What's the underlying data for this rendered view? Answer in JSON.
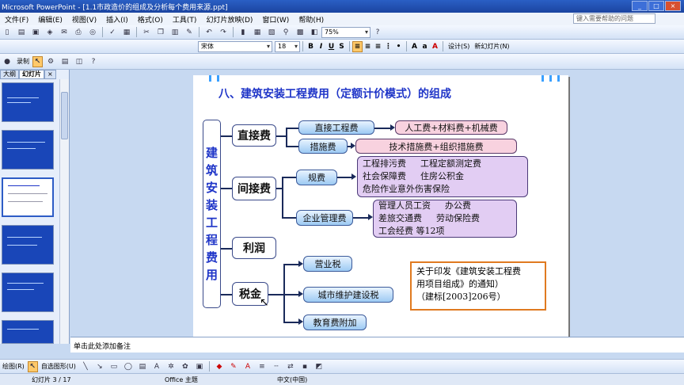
{
  "window": {
    "title": "Microsoft PowerPoint - [1.1市政造价的组成及分析每个费用来源.ppt]"
  },
  "menu": [
    "文件(F)",
    "编辑(E)",
    "视图(V)",
    "插入(I)",
    "格式(O)",
    "工具(T)",
    "幻灯片放映(D)",
    "窗口(W)",
    "帮助(H)"
  ],
  "help_placeholder": "键入需要帮助的问题",
  "toolbar": {
    "zoom": "75%",
    "font": "宋体",
    "font_size": "18",
    "design_label": "设计(S)",
    "new_slide_label": "新幻灯片(N)",
    "record_label": "录制"
  },
  "left_panel": {
    "tab_outline": "大纲",
    "tab_slides": "幻灯片"
  },
  "slide": {
    "title": "八、建筑安装工程费用（定额计价模式）的组成",
    "root": "建筑安装工程费用",
    "direct": "直接费",
    "direct_eng": "直接工程费",
    "direct_eng_detail": "人工费+材料费+机械费",
    "measures": "措施费",
    "measures_detail": "技术措施费+组织措施费",
    "indirect": "间接费",
    "fees": "规费",
    "fees_line1a": "工程排污费",
    "fees_line1b": "工程定额测定费",
    "fees_line2a": "社会保障费",
    "fees_line2b": "住房公积金",
    "fees_line3": "危险作业意外伤害保险",
    "mgmt": "企业管理费",
    "mgmt_line1a": "管理人员工资",
    "mgmt_line1b": "办公费",
    "mgmt_line2a": "差旅交通费",
    "mgmt_line2b": "劳动保险费",
    "mgmt_line3": "工会经费  等12项",
    "profit": "利润",
    "tax": "税金",
    "tax1": "营业税",
    "tax2": "城市维护建设税",
    "tax3": "教育费附加",
    "note_line1": "关于印发《建筑安装工程费",
    "note_line2": "用项目组成》的通知）",
    "note_line3": "（建标[2003]206号）"
  },
  "notes_placeholder": "单击此处添加备注",
  "drawbar": {
    "draw_label": "绘图(R)",
    "autoshape_label": "自选图形(U)"
  },
  "status": {
    "slide_pos": "幻灯片 3 / 17",
    "theme": "Office 主题",
    "language": "中文(中国)"
  },
  "colors": {
    "title_blue": "#1f35c8",
    "pink_box": "#f8d2df",
    "purple_box": "#e2cdf3",
    "blue_box": "#9dcaf3",
    "note_border": "#e07a20"
  }
}
